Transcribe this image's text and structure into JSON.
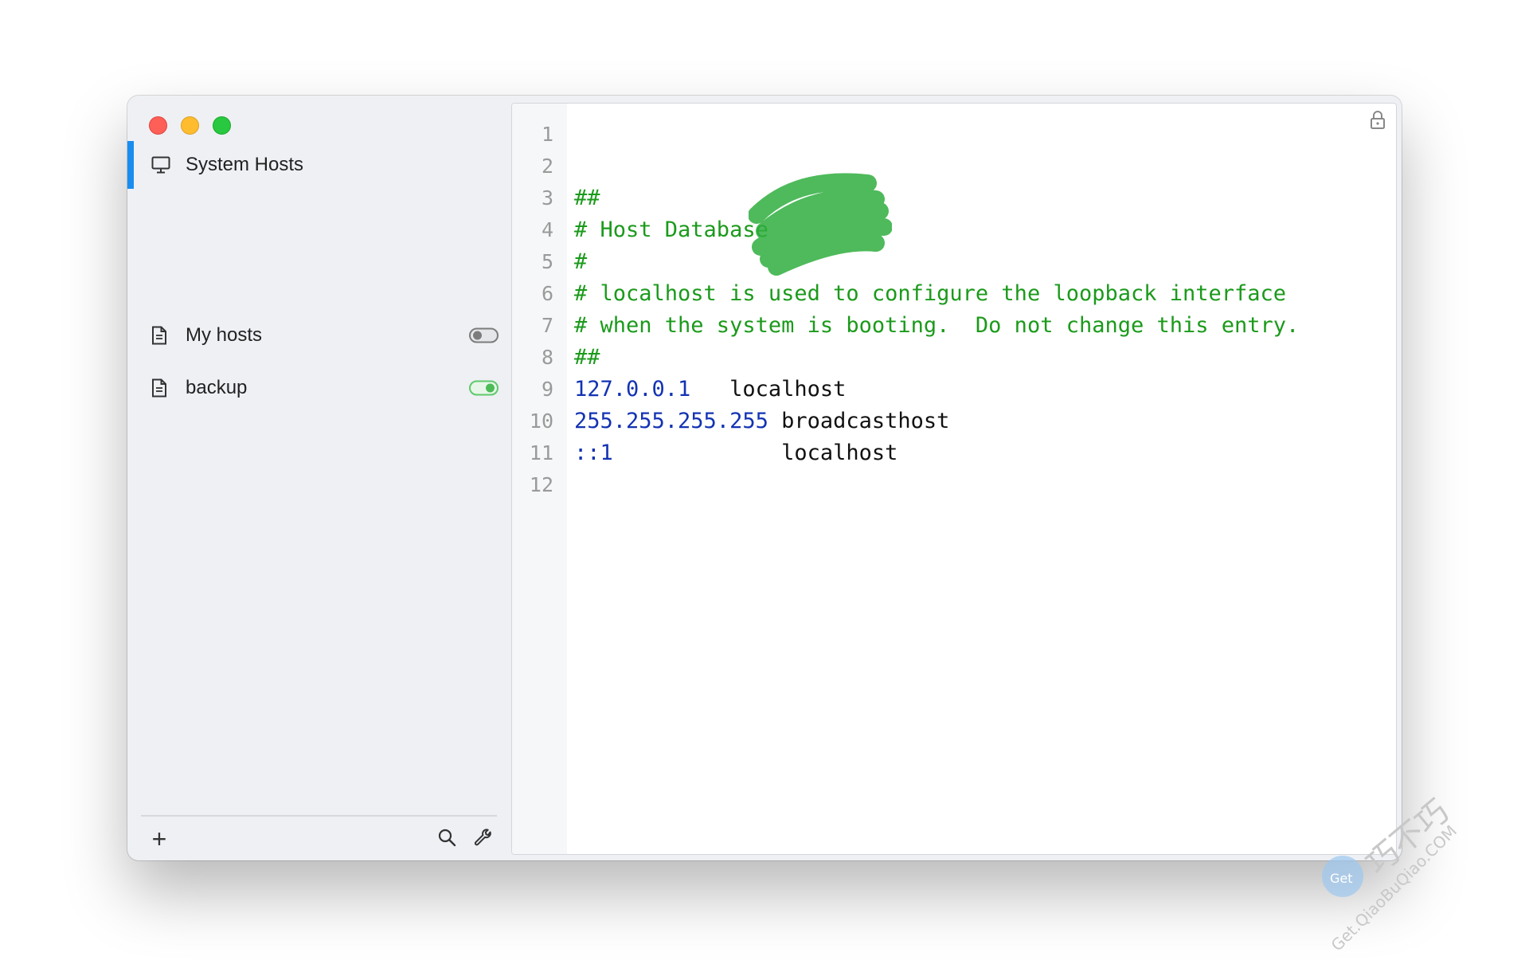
{
  "sidebar": {
    "items": [
      {
        "label": "System Hosts",
        "icon": "monitor-icon",
        "selected": true
      },
      {
        "label": "My hosts",
        "icon": "document-icon",
        "enabled": false
      },
      {
        "label": "backup",
        "icon": "document-icon",
        "enabled": true
      }
    ],
    "bottom": {
      "add": "+",
      "search_icon": "search-icon",
      "settings_icon": "wrench-icon"
    }
  },
  "editor": {
    "locked_icon": "lock-icon",
    "lines": [
      {
        "num": "1",
        "text": "",
        "type": "comment"
      },
      {
        "num": "2",
        "text": "",
        "type": "comment"
      },
      {
        "num": "3",
        "text": "##",
        "type": "comment"
      },
      {
        "num": "4",
        "text": "# Host Database",
        "type": "comment"
      },
      {
        "num": "5",
        "text": "#",
        "type": "comment"
      },
      {
        "num": "6",
        "text": "# localhost is used to configure the loopback interface",
        "type": "comment"
      },
      {
        "num": "7",
        "text": "# when the system is booting.  Do not change this entry.",
        "type": "comment"
      },
      {
        "num": "8",
        "text": "##",
        "type": "comment"
      },
      {
        "num": "9",
        "ip": "127.0.0.1",
        "host": "   localhost",
        "type": "entry"
      },
      {
        "num": "10",
        "ip": "255.255.255.255",
        "host": " broadcasthost",
        "type": "entry"
      },
      {
        "num": "11",
        "ip": "::1",
        "host": "             localhost",
        "type": "entry"
      },
      {
        "num": "12",
        "text": "",
        "type": "comment"
      }
    ]
  },
  "watermark": {
    "brand": "巧不巧",
    "site": "Get.QiaoBuQiao.COM",
    "badge": "Get"
  },
  "colors": {
    "accent": "#1a8cf0",
    "comment": "#1b9a1b",
    "ip": "#1333b3",
    "toggle_on": "#5ec96a"
  }
}
